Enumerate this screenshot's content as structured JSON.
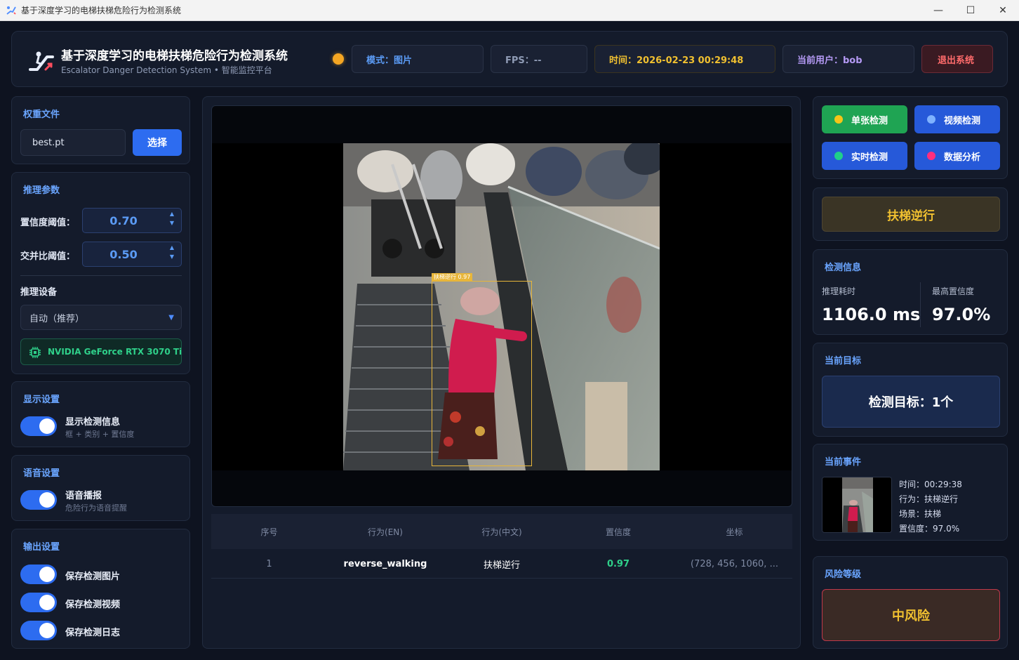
{
  "window": {
    "title": "基于深度学习的电梯扶梯危险行为检测系统",
    "minimize_glyph": "—",
    "maximize_glyph": "☐",
    "close_glyph": "✕"
  },
  "header": {
    "title": "基于深度学习的电梯扶梯危险行为检测系统",
    "subtitle": "Escalator Danger Detection System • 智能监控平台",
    "mode": "模式：图片",
    "fps": "FPS：--",
    "time": "时间：2026-02-23 00:29:48",
    "user": "当前用户：bob",
    "logout": "退出系统",
    "status_color": "#f5a623"
  },
  "weights": {
    "title": "权重文件",
    "value": "best.pt",
    "select_label": "选择"
  },
  "inference": {
    "title": "推理参数",
    "conf_label": "置信度阈值：",
    "conf_value": "0.70",
    "iou_label": "交并比阈值：",
    "iou_value": "0.50",
    "device_label": "推理设备",
    "device_value": "自动（推荐）",
    "gpu_name": "NVIDIA GeForce RTX 3070 Ti"
  },
  "display": {
    "title": "显示设置",
    "toggle_label": "显示检测信息",
    "toggle_sub": "框 + 类别 + 置信度",
    "toggle_on": true
  },
  "voice": {
    "title": "语音设置",
    "toggle_label": "语音播报",
    "toggle_sub": "危险行为语音提醒",
    "toggle_on": true
  },
  "output": {
    "title": "输出设置",
    "items": [
      {
        "label": "保存检测图片",
        "on": true
      },
      {
        "label": "保存检测视频",
        "on": true
      },
      {
        "label": "保存检测日志",
        "on": true
      }
    ]
  },
  "viewer": {
    "box_label": "扶梯逆行 0.97"
  },
  "table": {
    "headers": [
      "序号",
      "行为(EN)",
      "行为(中文)",
      "置信度",
      "坐标"
    ],
    "rows": [
      {
        "index": "1",
        "en": "reverse_walking",
        "cn": "扶梯逆行",
        "conf": "0.97",
        "coords": "(728, 456, 1060, ..."
      }
    ]
  },
  "modes": {
    "single": "单张检测",
    "video": "视频检测",
    "realtime": "实时检测",
    "analysis": "数据分析",
    "colors": {
      "single_dot": "#f5c518",
      "video_dot": "#7fb2ff",
      "realtime_dot": "#1fd08a",
      "analysis_dot": "#ff2e7e"
    }
  },
  "alert": {
    "text": "扶梯逆行"
  },
  "detect_info": {
    "title": "检测信息",
    "latency_label": "推理耗时",
    "latency_value": "1106.0 ms",
    "maxconf_label": "最高置信度",
    "maxconf_value": "97.0%"
  },
  "current_target": {
    "title": "当前目标",
    "text": "检测目标：1个"
  },
  "current_event": {
    "title": "当前事件",
    "time": "时间：00:29:38",
    "behavior": "行为：扶梯逆行",
    "scene": "场景：扶梯",
    "confidence": "置信度：97.0%"
  },
  "risk": {
    "title": "风险等级",
    "level": "中风险"
  }
}
